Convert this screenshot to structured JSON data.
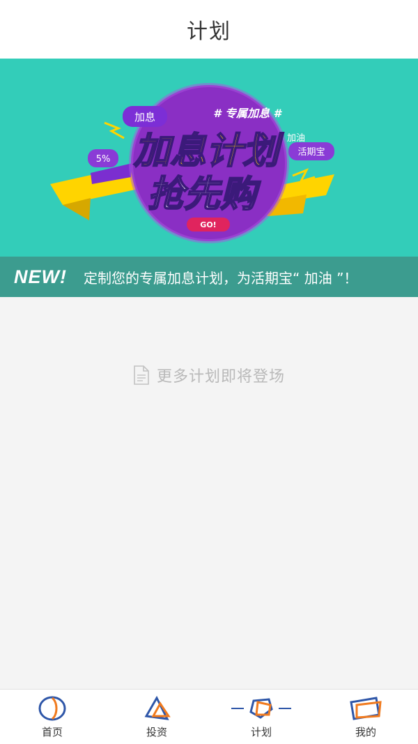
{
  "header": {
    "title": "计划"
  },
  "banner": {
    "art": {
      "tag_top": "加息",
      "hashtag": "# 专属加息 #",
      "title_line1": "加息计划",
      "title_line2": "抢先购",
      "rate_tag": "5%",
      "side_tag1": "加油",
      "side_tag2": "活期宝",
      "go_button": "GO!"
    },
    "strip": {
      "badge": "NEW!",
      "text": "定制您的专属加息计划，为活期宝“ 加油 ”！"
    }
  },
  "content": {
    "empty_message": "更多计划即将登场"
  },
  "tabbar": {
    "items": [
      {
        "label": "首页",
        "icon": "home-icon"
      },
      {
        "label": "投资",
        "icon": "invest-icon"
      },
      {
        "label": "计划",
        "icon": "plan-icon",
        "active": true
      },
      {
        "label": "我的",
        "icon": "profile-icon"
      }
    ]
  },
  "colors": {
    "banner_bg": "#33cdb9",
    "strip_bg": "#3c9c8f",
    "purple": "#8a2fc4",
    "yellow": "#ffd400",
    "icon_blue": "#2e56a8",
    "icon_orange": "#f07a1e"
  }
}
